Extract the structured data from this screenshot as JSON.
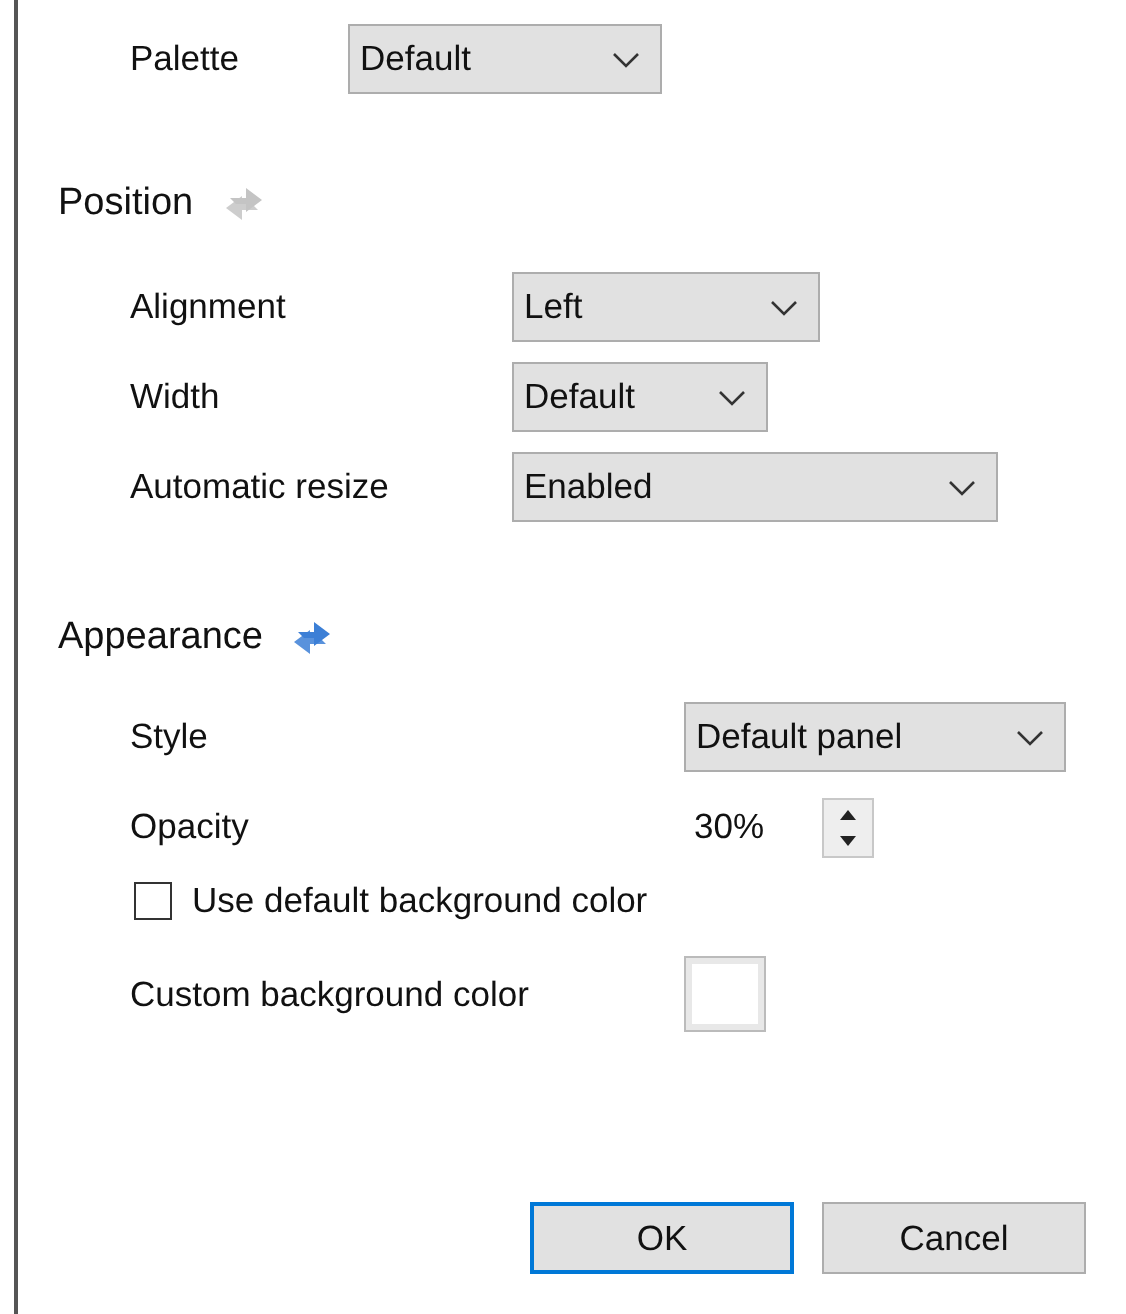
{
  "palette": {
    "label": "Palette",
    "value": "Default"
  },
  "sections": [
    {
      "title": "Position",
      "sync_enabled": false,
      "rows": [
        {
          "kind": "dropdown",
          "label": "Alignment",
          "value": "Left"
        },
        {
          "kind": "dropdown",
          "label": "Width",
          "value": "Default"
        },
        {
          "kind": "dropdown",
          "label": "Automatic resize",
          "value": "Enabled"
        }
      ]
    },
    {
      "title": "Appearance",
      "sync_enabled": true,
      "rows": [
        {
          "kind": "dropdown",
          "label": "Style",
          "value": "Default panel"
        },
        {
          "kind": "spinner",
          "label": "Opacity",
          "value": "30%"
        },
        {
          "kind": "checkbox",
          "label": "Use default background color",
          "checked": false
        },
        {
          "kind": "color",
          "label": "Custom background color",
          "color": "#ffffff"
        }
      ]
    }
  ],
  "buttons": [
    {
      "label": "OK",
      "default": true
    },
    {
      "label": "Cancel",
      "default": false
    }
  ]
}
